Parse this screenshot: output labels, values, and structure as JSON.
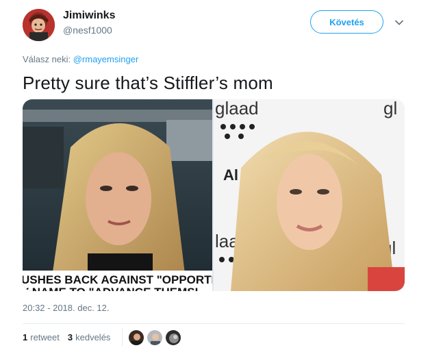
{
  "tweet": {
    "display_name": "Jimiwinks",
    "handle": "@nesf1000",
    "follow_label": "Követés",
    "reply_prefix": "Válasz neki:",
    "reply_mention": "@rmayemsinger",
    "text": "Pretty sure that’s Stiffler’s mom",
    "timestamp": "20:32 - 2018. dec. 12.",
    "retweet_count": "1",
    "retweet_label": "retweet",
    "like_count": "3",
    "like_label": "kedvelés"
  },
  "media": {
    "left_caption_line1": "USHES BACK AGAINST \"OPPORTI",
    "left_caption_line2": "Y NAME TO \"ADVANCE THEMSI",
    "right_logo_text_1": "glaad",
    "right_logo_text_2": "gl",
    "right_logo_text_3": "laa",
    "right_logo_text_4": "gl",
    "right_logo_text_5": "Al"
  },
  "colors": {
    "accent": "#1da1f2",
    "secondary_text": "#657786",
    "primary_text": "#14171a"
  },
  "icons": {
    "caret": "chevron-down-icon"
  }
}
